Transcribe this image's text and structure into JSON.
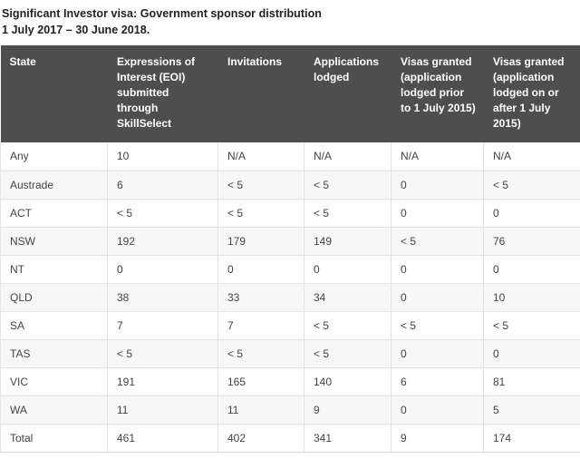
{
  "caption": {
    "line1": "Significant Investor visa: Government sponsor distribution",
    "line2": "1 July 2017 – 30 June 2018."
  },
  "table": {
    "headers": [
      "State",
      "Expressions of Interest (EOI) submitted through SkillSelect",
      "Invitations",
      "Applications lodged",
      "Visas granted (application lodged prior to 1 July 2015)",
      "Visas granted (application lodged on or after 1 July 2015)"
    ],
    "rows": [
      {
        "state": "Any",
        "eoi": "10",
        "invitations": "N/A",
        "applications": "N/A",
        "visas_prior": "N/A",
        "visas_after": "N/A"
      },
      {
        "state": "Austrade",
        "eoi": "6",
        "invitations": "< 5",
        "applications": "< 5",
        "visas_prior": "0",
        "visas_after": "< 5"
      },
      {
        "state": "ACT",
        "eoi": "< 5",
        "invitations": "< 5",
        "applications": "< 5",
        "visas_prior": "0",
        "visas_after": "0"
      },
      {
        "state": "NSW",
        "eoi": "192",
        "invitations": "179",
        "applications": "149",
        "visas_prior": "< 5",
        "visas_after": "76"
      },
      {
        "state": "NT",
        "eoi": "0",
        "invitations": "0",
        "applications": "0",
        "visas_prior": "0",
        "visas_after": "0"
      },
      {
        "state": "QLD",
        "eoi": "38",
        "invitations": "33",
        "applications": "34",
        "visas_prior": "0",
        "visas_after": "10"
      },
      {
        "state": "SA",
        "eoi": "7",
        "invitations": "7",
        "applications": "< 5",
        "visas_prior": "< 5",
        "visas_after": "< 5"
      },
      {
        "state": "TAS",
        "eoi": "< 5",
        "invitations": "< 5",
        "applications": "< 5",
        "visas_prior": "0",
        "visas_after": "0"
      },
      {
        "state": "VIC",
        "eoi": "191",
        "invitations": "165",
        "applications": "140",
        "visas_prior": "6",
        "visas_after": "81"
      },
      {
        "state": "WA",
        "eoi": "11",
        "invitations": "11",
        "applications": "9",
        "visas_prior": "0",
        "visas_after": "5"
      },
      {
        "state": "Total",
        "eoi": "461",
        "invitations": "402",
        "applications": "341",
        "visas_prior": "9",
        "visas_after": "174"
      }
    ]
  },
  "colors": {
    "header_background": "#4e4e4e",
    "header_text": "#ffffff",
    "row_alt_background": "#f7f7f7",
    "cell_border": "#e2e2e2",
    "body_text": "#444444"
  }
}
